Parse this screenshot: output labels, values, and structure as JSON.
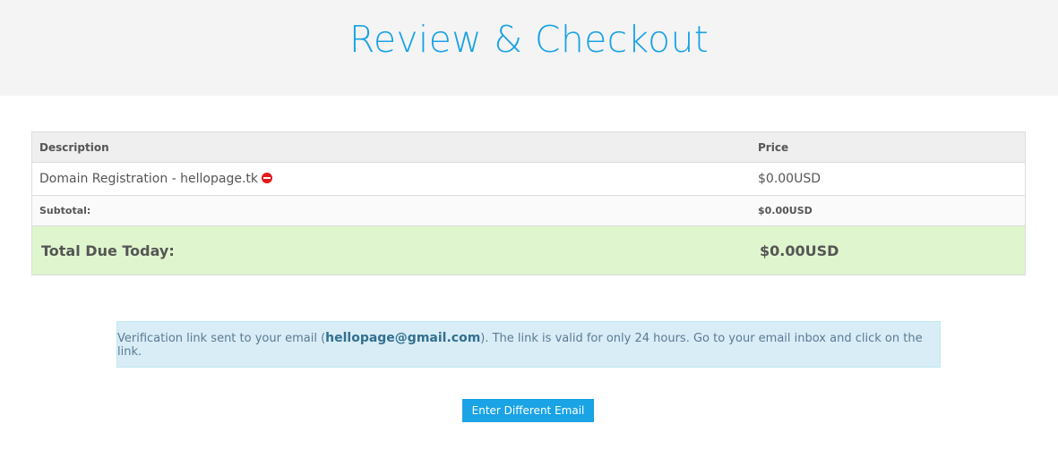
{
  "page": {
    "title": "Review & Checkout"
  },
  "cart": {
    "headers": {
      "description": "Description",
      "price": "Price"
    },
    "items": [
      {
        "description": "Domain Registration - hellopage.tk",
        "price": "$0.00USD",
        "icon": "remove-icon"
      }
    ],
    "subtotal": {
      "label": "Subtotal:",
      "value": "$0.00USD"
    },
    "total": {
      "label": "Total Due Today:",
      "value": "$0.00USD"
    }
  },
  "notice": {
    "prefix": "Verification link sent to your email (",
    "email": "hellopage@gmail.com",
    "suffix": "). The link is valid for only 24 hours. Go to your email inbox and click on the link."
  },
  "actions": {
    "different_email_label": "Enter Different Email"
  },
  "colors": {
    "accent": "#1aa3e5",
    "total_bg": "#dff5ce",
    "notice_bg": "#d9edf7",
    "remove_icon": "#e3191b"
  }
}
